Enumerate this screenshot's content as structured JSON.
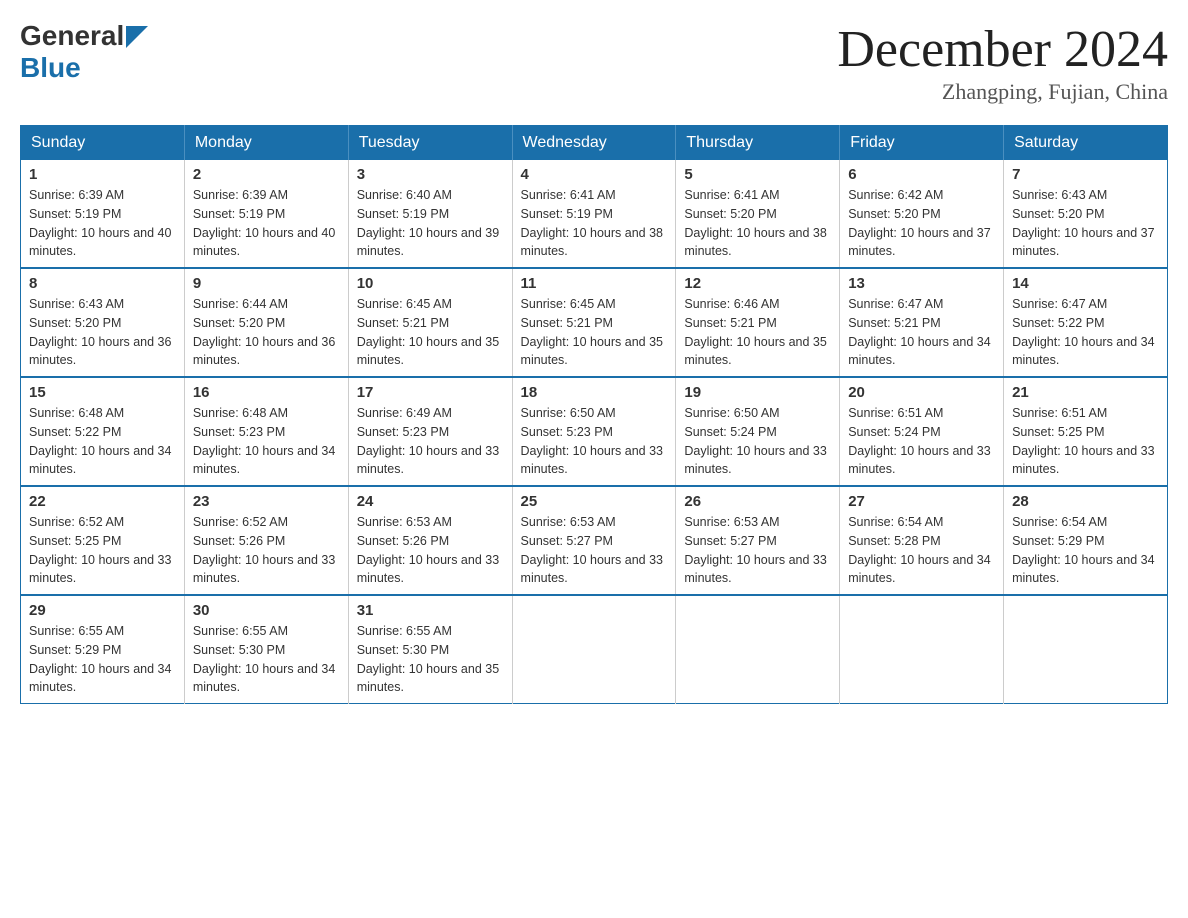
{
  "header": {
    "logo_general": "General",
    "logo_blue": "Blue",
    "month_title": "December 2024",
    "subtitle": "Zhangping, Fujian, China"
  },
  "calendar": {
    "days_of_week": [
      "Sunday",
      "Monday",
      "Tuesday",
      "Wednesday",
      "Thursday",
      "Friday",
      "Saturday"
    ],
    "weeks": [
      [
        {
          "day": "1",
          "sunrise": "6:39 AM",
          "sunset": "5:19 PM",
          "daylight": "10 hours and 40 minutes."
        },
        {
          "day": "2",
          "sunrise": "6:39 AM",
          "sunset": "5:19 PM",
          "daylight": "10 hours and 40 minutes."
        },
        {
          "day": "3",
          "sunrise": "6:40 AM",
          "sunset": "5:19 PM",
          "daylight": "10 hours and 39 minutes."
        },
        {
          "day": "4",
          "sunrise": "6:41 AM",
          "sunset": "5:19 PM",
          "daylight": "10 hours and 38 minutes."
        },
        {
          "day": "5",
          "sunrise": "6:41 AM",
          "sunset": "5:20 PM",
          "daylight": "10 hours and 38 minutes."
        },
        {
          "day": "6",
          "sunrise": "6:42 AM",
          "sunset": "5:20 PM",
          "daylight": "10 hours and 37 minutes."
        },
        {
          "day": "7",
          "sunrise": "6:43 AM",
          "sunset": "5:20 PM",
          "daylight": "10 hours and 37 minutes."
        }
      ],
      [
        {
          "day": "8",
          "sunrise": "6:43 AM",
          "sunset": "5:20 PM",
          "daylight": "10 hours and 36 minutes."
        },
        {
          "day": "9",
          "sunrise": "6:44 AM",
          "sunset": "5:20 PM",
          "daylight": "10 hours and 36 minutes."
        },
        {
          "day": "10",
          "sunrise": "6:45 AM",
          "sunset": "5:21 PM",
          "daylight": "10 hours and 35 minutes."
        },
        {
          "day": "11",
          "sunrise": "6:45 AM",
          "sunset": "5:21 PM",
          "daylight": "10 hours and 35 minutes."
        },
        {
          "day": "12",
          "sunrise": "6:46 AM",
          "sunset": "5:21 PM",
          "daylight": "10 hours and 35 minutes."
        },
        {
          "day": "13",
          "sunrise": "6:47 AM",
          "sunset": "5:21 PM",
          "daylight": "10 hours and 34 minutes."
        },
        {
          "day": "14",
          "sunrise": "6:47 AM",
          "sunset": "5:22 PM",
          "daylight": "10 hours and 34 minutes."
        }
      ],
      [
        {
          "day": "15",
          "sunrise": "6:48 AM",
          "sunset": "5:22 PM",
          "daylight": "10 hours and 34 minutes."
        },
        {
          "day": "16",
          "sunrise": "6:48 AM",
          "sunset": "5:23 PM",
          "daylight": "10 hours and 34 minutes."
        },
        {
          "day": "17",
          "sunrise": "6:49 AM",
          "sunset": "5:23 PM",
          "daylight": "10 hours and 33 minutes."
        },
        {
          "day": "18",
          "sunrise": "6:50 AM",
          "sunset": "5:23 PM",
          "daylight": "10 hours and 33 minutes."
        },
        {
          "day": "19",
          "sunrise": "6:50 AM",
          "sunset": "5:24 PM",
          "daylight": "10 hours and 33 minutes."
        },
        {
          "day": "20",
          "sunrise": "6:51 AM",
          "sunset": "5:24 PM",
          "daylight": "10 hours and 33 minutes."
        },
        {
          "day": "21",
          "sunrise": "6:51 AM",
          "sunset": "5:25 PM",
          "daylight": "10 hours and 33 minutes."
        }
      ],
      [
        {
          "day": "22",
          "sunrise": "6:52 AM",
          "sunset": "5:25 PM",
          "daylight": "10 hours and 33 minutes."
        },
        {
          "day": "23",
          "sunrise": "6:52 AM",
          "sunset": "5:26 PM",
          "daylight": "10 hours and 33 minutes."
        },
        {
          "day": "24",
          "sunrise": "6:53 AM",
          "sunset": "5:26 PM",
          "daylight": "10 hours and 33 minutes."
        },
        {
          "day": "25",
          "sunrise": "6:53 AM",
          "sunset": "5:27 PM",
          "daylight": "10 hours and 33 minutes."
        },
        {
          "day": "26",
          "sunrise": "6:53 AM",
          "sunset": "5:27 PM",
          "daylight": "10 hours and 33 minutes."
        },
        {
          "day": "27",
          "sunrise": "6:54 AM",
          "sunset": "5:28 PM",
          "daylight": "10 hours and 34 minutes."
        },
        {
          "day": "28",
          "sunrise": "6:54 AM",
          "sunset": "5:29 PM",
          "daylight": "10 hours and 34 minutes."
        }
      ],
      [
        {
          "day": "29",
          "sunrise": "6:55 AM",
          "sunset": "5:29 PM",
          "daylight": "10 hours and 34 minutes."
        },
        {
          "day": "30",
          "sunrise": "6:55 AM",
          "sunset": "5:30 PM",
          "daylight": "10 hours and 34 minutes."
        },
        {
          "day": "31",
          "sunrise": "6:55 AM",
          "sunset": "5:30 PM",
          "daylight": "10 hours and 35 minutes."
        },
        null,
        null,
        null,
        null
      ]
    ]
  }
}
